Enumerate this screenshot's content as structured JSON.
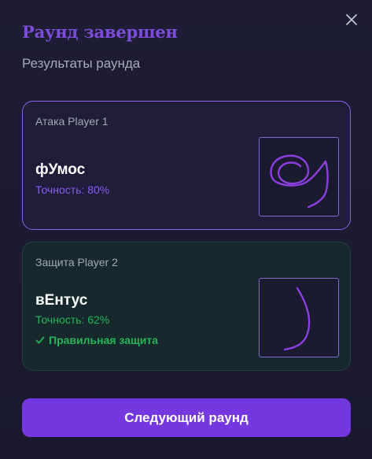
{
  "modal": {
    "title": "Раунд завершен",
    "subtitle": "Результаты раунда"
  },
  "attack": {
    "label": "Атака Player 1",
    "word": "фУмос",
    "accuracy": "Точность: 80%",
    "accuracy_value": 80,
    "accent_color": "#8a5cf0"
  },
  "defense": {
    "label": "Защита Player 2",
    "word": "вЕнтус",
    "accuracy": "Точность: 62%",
    "accuracy_value": 62,
    "verdict": "Правильная защита",
    "accent_color": "#27b45a"
  },
  "actions": {
    "next_round": "Следующий раунд"
  },
  "icons": {
    "close": "close-icon",
    "check": "check-icon"
  }
}
